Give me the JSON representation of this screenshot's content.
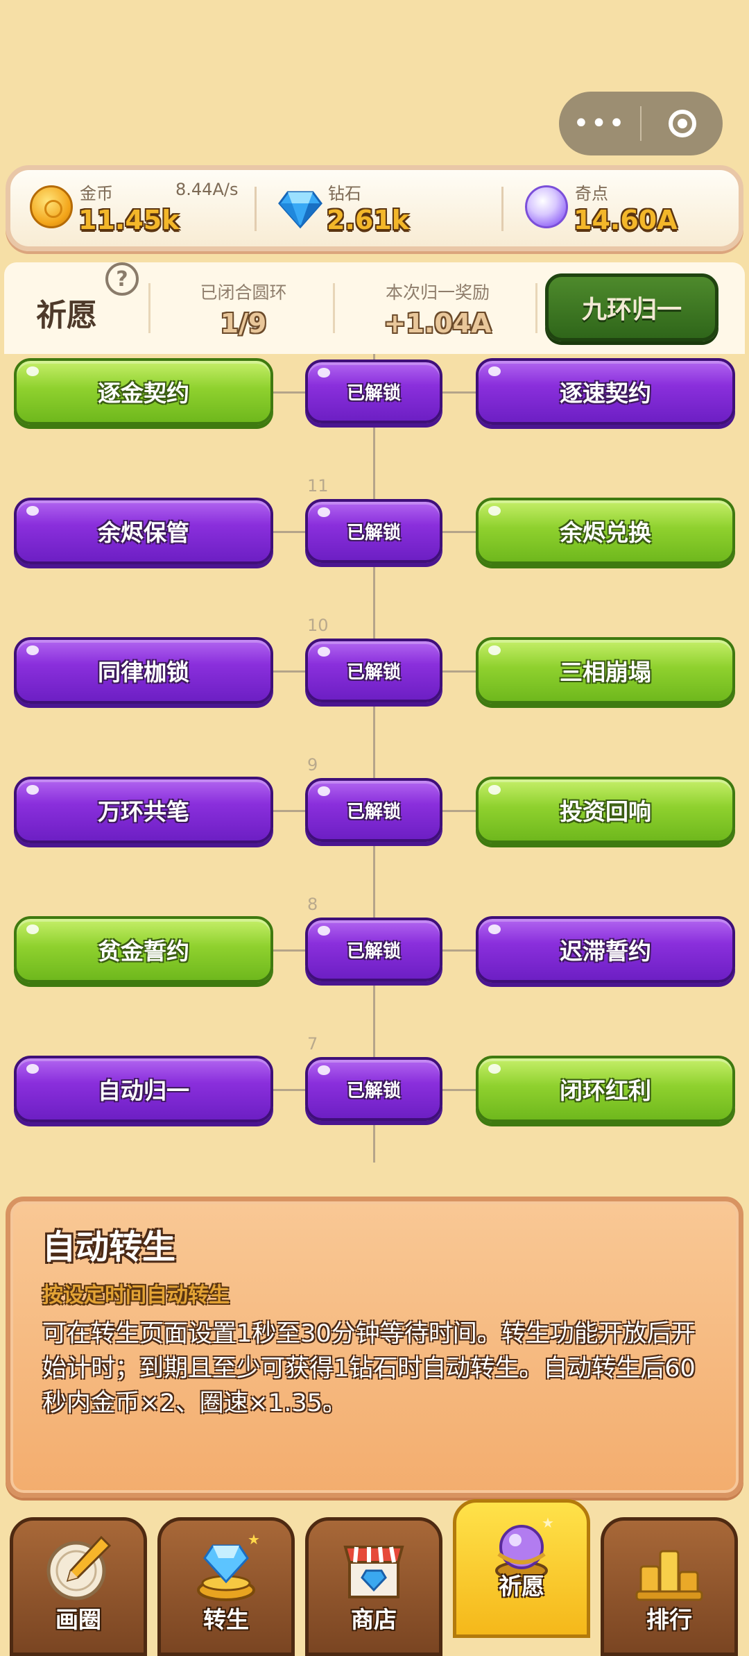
{
  "capsule": {
    "more_icon": "more-dots-icon",
    "close_icon": "target-circle-icon"
  },
  "currencies": [
    {
      "icon": "gold-coin-icon",
      "label": "金币",
      "rate": "8.44A/s",
      "value": "11.45k"
    },
    {
      "icon": "diamond-icon",
      "label": "钻石",
      "value": "2.61k"
    },
    {
      "icon": "purple-orb-icon",
      "label": "奇点",
      "value": "14.60A"
    }
  ],
  "wish": {
    "title": "祈愿",
    "help_icon": "?",
    "closed_rings_label": "已闭合圆环",
    "closed_rings_value": "1/9",
    "reward_label": "本次归一奖励",
    "reward_value": "+1.04A",
    "button": "九环归一"
  },
  "tree": {
    "rows": [
      {
        "number": "",
        "left": "逐金契约",
        "left_color": "green",
        "center": "已解锁",
        "right": "逐速契约",
        "right_color": "purple"
      },
      {
        "number": "11",
        "left": "余烬保管",
        "left_color": "purple",
        "center": "已解锁",
        "right": "余烬兑换",
        "right_color": "green"
      },
      {
        "number": "10",
        "left": "同律枷锁",
        "left_color": "purple",
        "center": "已解锁",
        "right": "三相崩塌",
        "right_color": "green"
      },
      {
        "number": "9",
        "left": "万环共笔",
        "left_color": "purple",
        "center": "已解锁",
        "right": "投资回响",
        "right_color": "green"
      },
      {
        "number": "8",
        "left": "贫金誓约",
        "left_color": "green",
        "center": "已解锁",
        "right": "迟滞誓约",
        "right_color": "purple"
      },
      {
        "number": "7",
        "left": "自动归一",
        "left_color": "purple",
        "center": "已解锁",
        "right": "闭环红利",
        "right_color": "green"
      }
    ]
  },
  "description": {
    "title": "自动转生",
    "subtitle": "按设定时间自动转生",
    "body": "可在转生页面设置1秒至30分钟等待时间。转生功能开放后开始计时；到期且至少可获得1钻石时自动转生。自动转生后60秒内金币×2、圈速×1.35。"
  },
  "nav": [
    {
      "label": "画圈",
      "icon": "pencil-circle-icon",
      "active": false
    },
    {
      "label": "转生",
      "icon": "diamond-pedestal-icon",
      "active": false
    },
    {
      "label": "商店",
      "icon": "shop-icon",
      "active": false
    },
    {
      "label": "祈愿",
      "icon": "crystal-orb-icon",
      "active": true
    },
    {
      "label": "排行",
      "icon": "podium-icon",
      "active": false
    }
  ],
  "colors": {
    "background": "#f6dfa6",
    "purple": "#8a2fdc",
    "green": "#8fd12e",
    "panel": "#f3ad6e"
  }
}
